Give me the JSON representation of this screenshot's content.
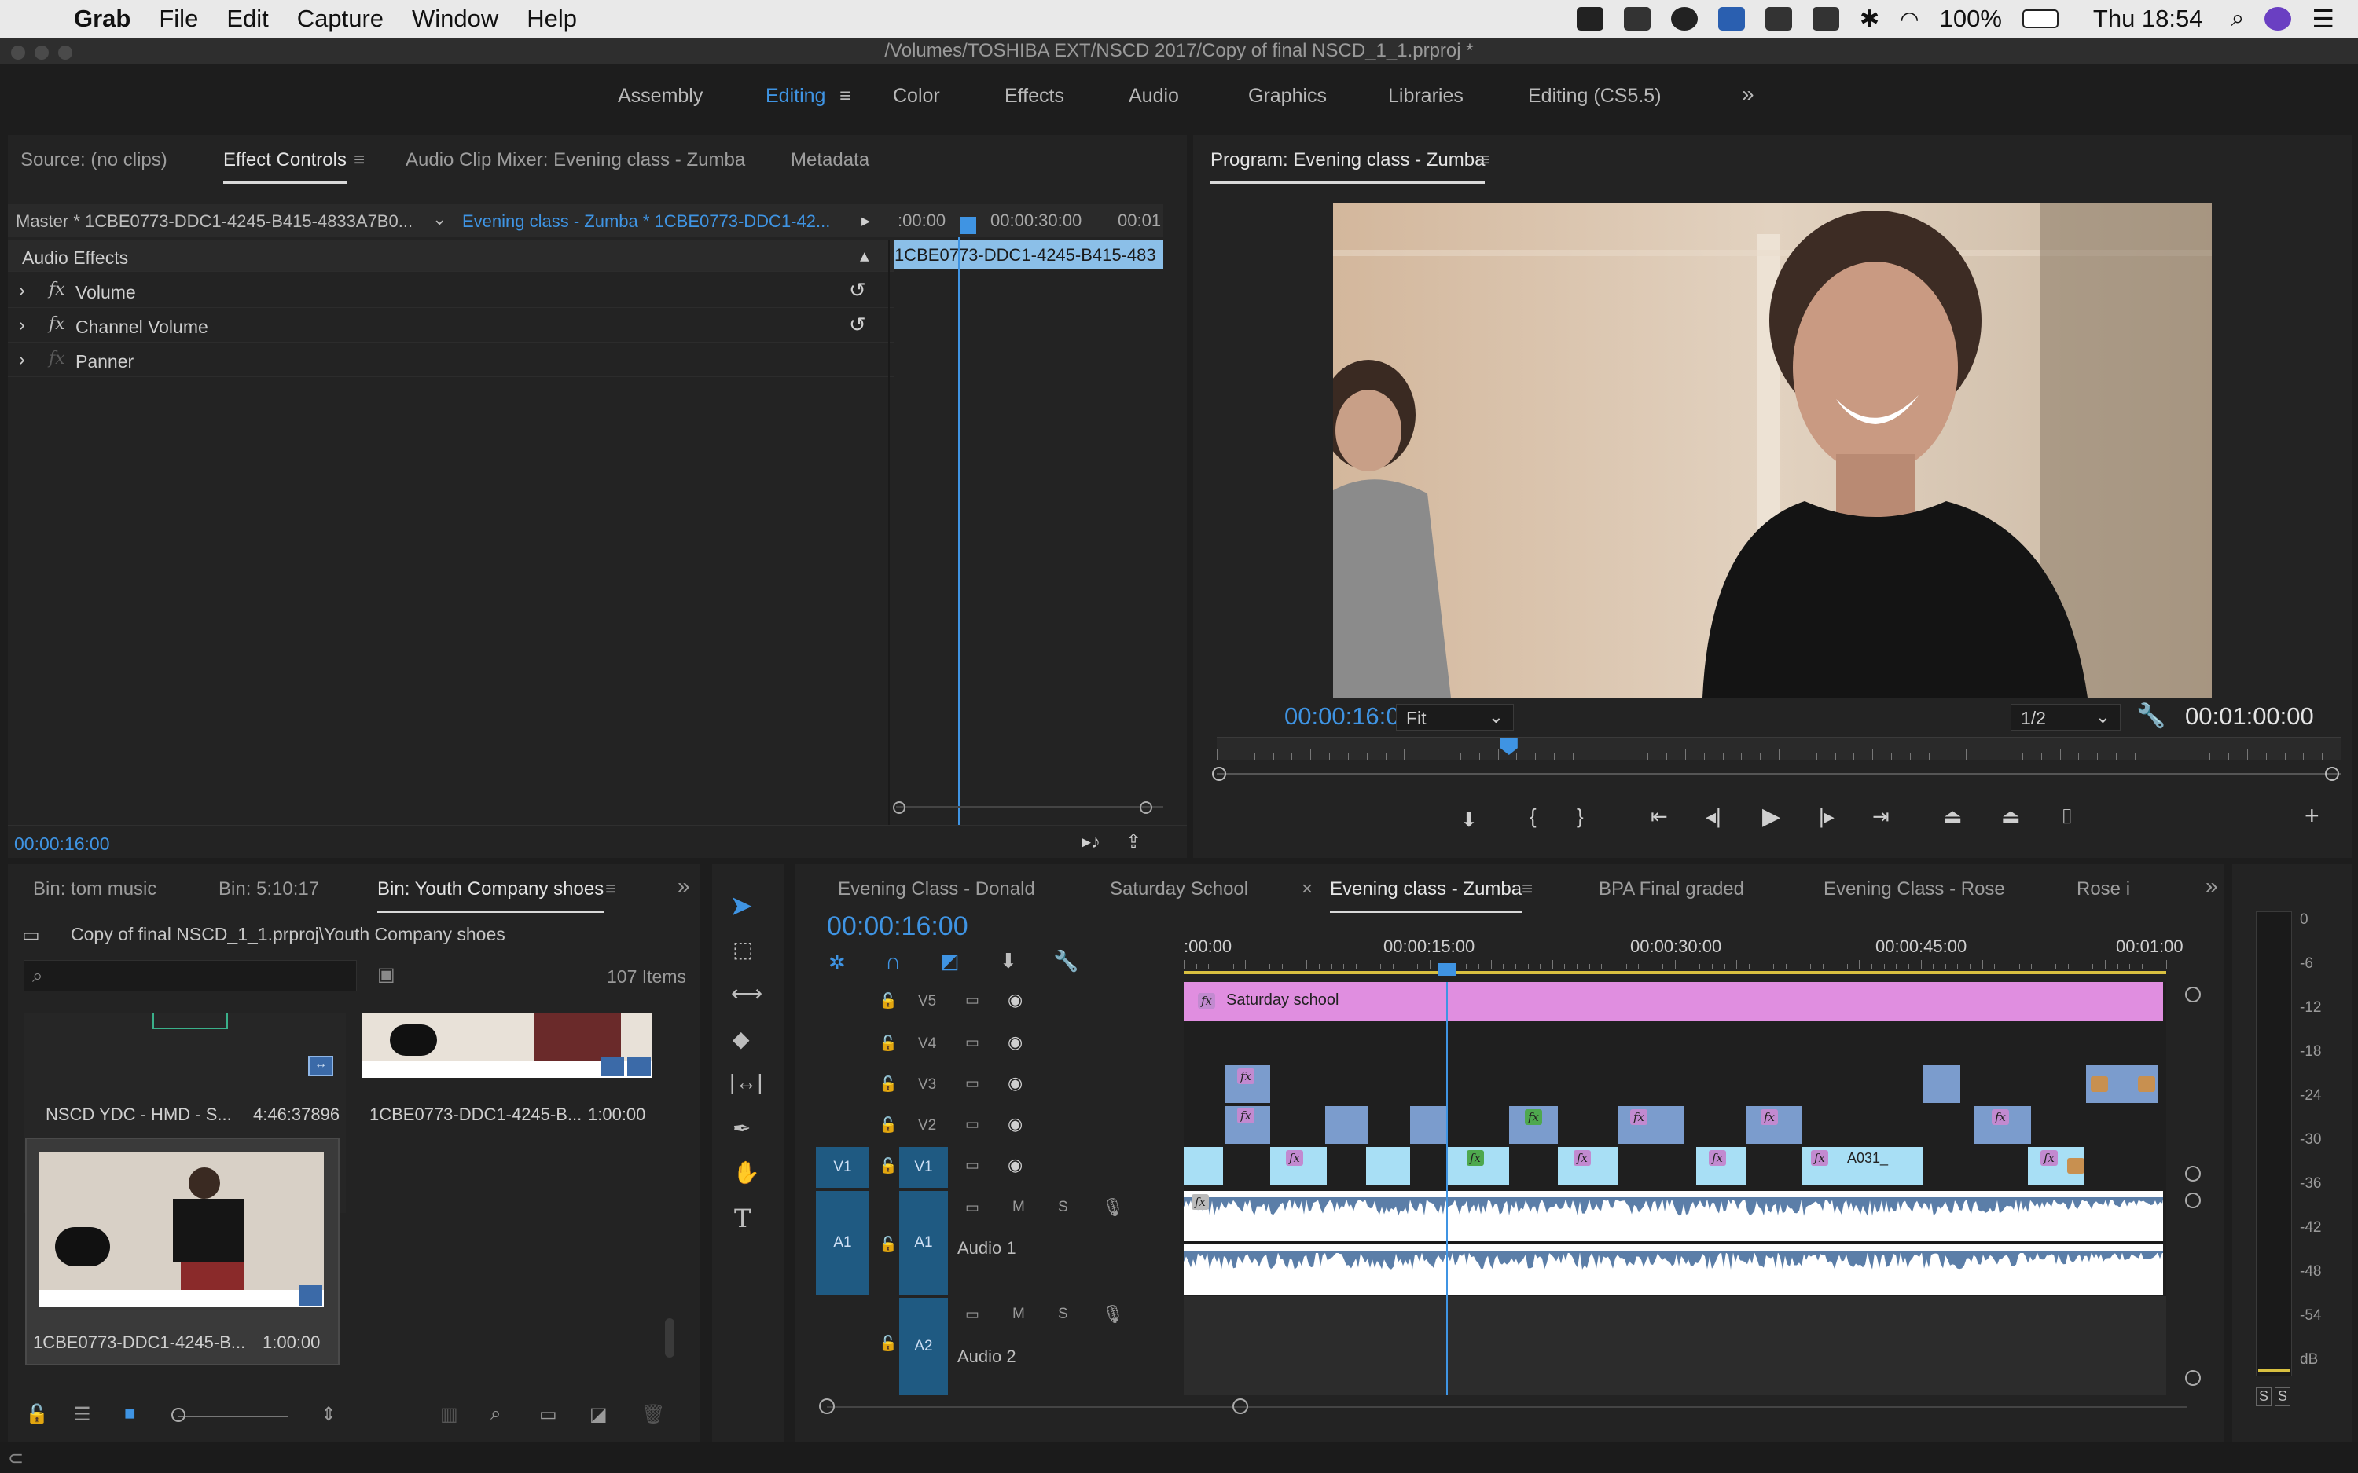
{
  "menubar": {
    "app": "Grab",
    "items": [
      "File",
      "Edit",
      "Capture",
      "Window",
      "Help"
    ],
    "battery": "100%",
    "clock": "Thu 18:54"
  },
  "window": {
    "title": "/Volumes/TOSHIBA EXT/NSCD 2017/Copy of final NSCD_1_1.prproj *"
  },
  "workspaces": [
    "Assembly",
    "Editing",
    "Color",
    "Effects",
    "Audio",
    "Graphics",
    "Libraries",
    "Editing (CS5.5)"
  ],
  "source_panel": {
    "tabs": [
      "Source: (no clips)",
      "Effect Controls",
      "Audio Clip Mixer: Evening class - Zumba",
      "Metadata"
    ],
    "master": "Master * 1CBE0773-DDC1-4245-B415-4833A7B0...",
    "sequence_clip": "Evening class - Zumba * 1CBE0773-DDC1-42...",
    "mini_ruler": [
      ":00:00",
      "00:00:30:00",
      "00:01"
    ],
    "mini_clip": "1CBE0773-DDC1-4245-B415-483",
    "section": "Audio Effects",
    "effects": [
      "Volume",
      "Channel Volume",
      "Panner"
    ],
    "timecode": "00:00:16:00"
  },
  "program_panel": {
    "title": "Program: Evening class - Zumba",
    "timecode": "00:00:16:00",
    "fit": "Fit",
    "resolution": "1/2",
    "duration": "00:01:00:00",
    "playhead_fraction": 0.26
  },
  "project_panel": {
    "tabs": [
      "Bin: tom music",
      "Bin: 5:10:17",
      "Bin: Youth Company shoes"
    ],
    "path": "Copy of final NSCD_1_1.prproj\\Youth Company shoes",
    "count": "107 Items",
    "search_placeholder": "",
    "items": [
      {
        "name": "NSCD YDC - HMD - S...",
        "duration": "4:46:37896"
      },
      {
        "name": "1CBE0773-DDC1-4245-B...",
        "duration": "1:00:00"
      },
      {
        "name": "1CBE0773-DDC1-4245-B...",
        "duration": "1:00:00"
      }
    ]
  },
  "timeline": {
    "tabs": [
      "Evening Class - Donald",
      "Saturday School",
      "Evening class - Zumba",
      "BPA Final graded",
      "Evening Class - Rose",
      "Rose i"
    ],
    "timecode": "00:00:16:00",
    "ruler": [
      ":00:00",
      "00:00:15:00",
      "00:00:30:00",
      "00:00:45:00",
      "00:01:00"
    ],
    "video_tracks": [
      "V5",
      "V4",
      "V3",
      "V2",
      "V1"
    ],
    "audio_tracks": [
      {
        "id": "A1",
        "name": "Audio 1"
      },
      {
        "id": "A2",
        "name": "Audio 2"
      }
    ],
    "source_patch_v": "V1",
    "source_patch_a": "A1",
    "v5_clip": "Saturday school",
    "v1_label": "A031_",
    "track_buttons": {
      "mute": "M",
      "solo": "S"
    }
  },
  "audio_meter": {
    "scale": [
      "0",
      "-6",
      "-12",
      "-18",
      "-24",
      "-30",
      "-36",
      "-42",
      "-48",
      "-54",
      "dB"
    ],
    "solo": [
      "S",
      "S"
    ]
  },
  "colors": {
    "accent": "#3f94e3",
    "v5clip": "#e08ee0",
    "v1clip": "#a8dff5",
    "v2clip": "#7b9ccd",
    "audio": "#5b7ea8"
  }
}
